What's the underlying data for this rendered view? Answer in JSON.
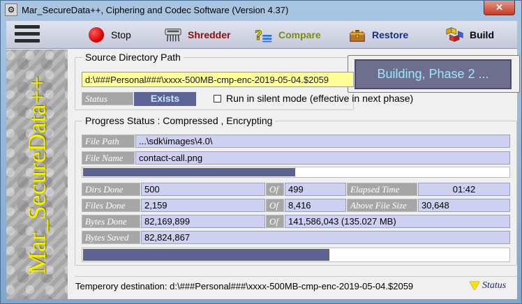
{
  "window": {
    "title": "Mar_SecureData++, Ciphering and Codec Software (Version 4.37)",
    "close_glyph": "✕"
  },
  "toolbar": {
    "stop": "Stop",
    "shredder": "Shredder",
    "compare": "Compare",
    "restore": "Restore",
    "build": "Build"
  },
  "sidebar": {
    "brand": "Mar_SecureData++"
  },
  "source": {
    "group_title": "Source Directory Path",
    "path": "d:\\###Personal###\\xxxx-500MB-cmp-enc-2019-05-04.$2059",
    "status_label": "Status",
    "status_value": "Exists",
    "silent_mode": "Run in silent mode (effective in next phase)",
    "silent_checked": false
  },
  "phase": {
    "text": "Building, Phase 2 ..."
  },
  "progress": {
    "group_title": "Progress Status :  Compressed ,  Encrypting",
    "file_path_label": "File Path",
    "file_path": "...\\sdk\\images\\4.0\\",
    "file_name_label": "File Name",
    "file_name": "contact-call.png",
    "file_progress": 0.5,
    "dirs_done_label": "Dirs Done",
    "dirs_done": "500",
    "dirs_of_label": "Of",
    "dirs_total": "499",
    "elapsed_label": "Elapsed Time",
    "elapsed": "01:42",
    "files_done_label": "Files Done",
    "files_done": "2,159",
    "files_of_label": "Of",
    "files_total": "8,416",
    "above_size_label": "Above File Size",
    "above_size": "30,648",
    "bytes_done_label": "Bytes Done",
    "bytes_done": "82,169,899",
    "bytes_of_label": "Of",
    "bytes_total": "141,586,043 (135.027 MB)",
    "bytes_saved_label": "Bytes Saved",
    "bytes_saved": "82,824,867",
    "overall_progress": 0.58
  },
  "statusbar": {
    "temp": "Temperory destination: d:\\###Personal###\\xxxx-500MB-cmp-enc-2019-05-04.$2059",
    "status_label": "Status"
  },
  "colors": {
    "accent": "#5c6390",
    "path_bg": "#ffff99",
    "value_bg": "#cdd0f0",
    "label_bg": "#a6a6a6",
    "brand_text": "#f5f200"
  }
}
